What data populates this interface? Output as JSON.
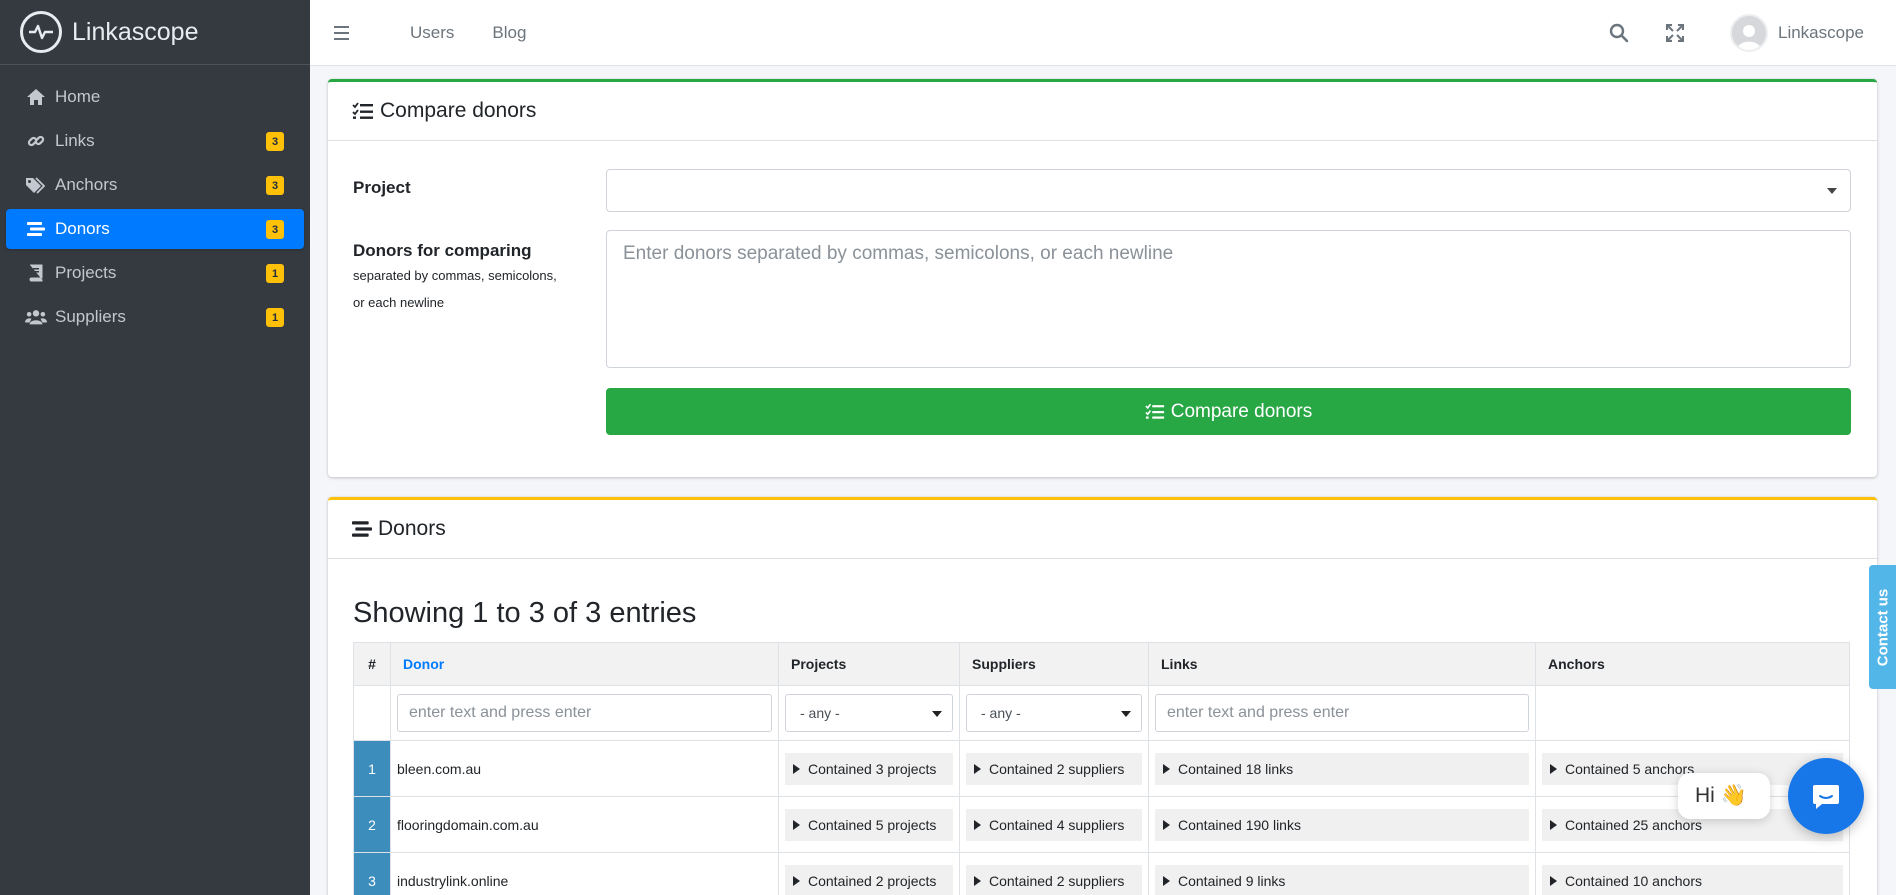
{
  "brand": {
    "name_bold": "Link",
    "name_rest": "ascope"
  },
  "sidebar": {
    "items": [
      {
        "label": "Home",
        "icon": "home-icon",
        "badge": null
      },
      {
        "label": "Links",
        "icon": "link-icon",
        "badge": "3"
      },
      {
        "label": "Anchors",
        "icon": "tags-icon",
        "badge": "3"
      },
      {
        "label": "Donors",
        "icon": "stream-icon",
        "badge": "3",
        "active": true
      },
      {
        "label": "Projects",
        "icon": "book-icon",
        "badge": "1"
      },
      {
        "label": "Suppliers",
        "icon": "users-icon",
        "badge": "1"
      }
    ]
  },
  "topbar": {
    "links": [
      "Users",
      "Blog"
    ],
    "user_name": "Linkascope"
  },
  "compare": {
    "title": "Compare donors",
    "project_label": "Project",
    "donors_label": "Donors for comparing",
    "donors_help": "separated by commas, semicolons, or each newline",
    "donors_placeholder": "Enter donors separated by commas, semicolons, or each newline",
    "button_label": "Compare donors"
  },
  "donors": {
    "title": "Donors",
    "entries_info": "Showing 1 to 3 of 3 entries",
    "columns": [
      "#",
      "Donor",
      "Projects",
      "Suppliers",
      "Links",
      "Anchors"
    ],
    "filters": {
      "text_placeholder": "enter text and press enter",
      "select_value": "- any -"
    },
    "rows": [
      {
        "index": "1",
        "donor": "bleen.com.au",
        "projects": "Contained 3 projects",
        "suppliers": "Contained 2 suppliers",
        "links": "Contained 18 links",
        "anchors": "Contained 5 anchors"
      },
      {
        "index": "2",
        "donor": "flooringdomain.com.au",
        "projects": "Contained 5 projects",
        "suppliers": "Contained 4 suppliers",
        "links": "Contained 190 links",
        "anchors": "Contained 25 anchors"
      },
      {
        "index": "3",
        "donor": "industrylink.online",
        "projects": "Contained 2 projects",
        "suppliers": "Contained 2 suppliers",
        "links": "Contained 9 links",
        "anchors": "Contained 10 anchors"
      }
    ]
  },
  "widgets": {
    "contact_tab": "Contact us",
    "hi_text": "Hi 👋"
  },
  "colors": {
    "primary": "#007bff",
    "success": "#28a745",
    "warning": "#ffc107",
    "sidebar": "#343a40",
    "index_cell": "#3c8dbc"
  }
}
